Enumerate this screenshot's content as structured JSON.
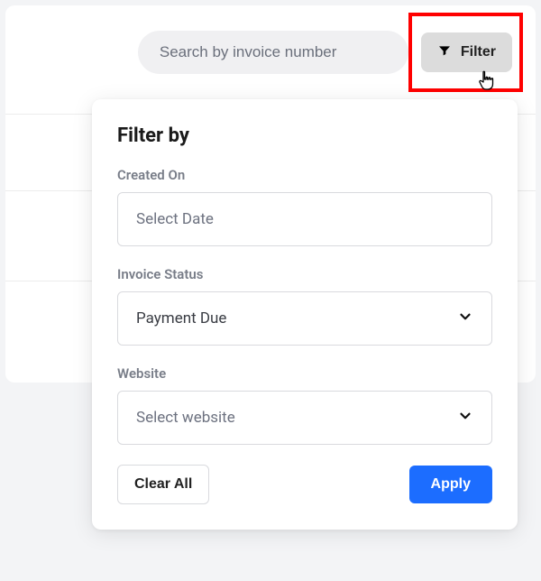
{
  "search": {
    "placeholder": "Search by invoice number"
  },
  "filter_button": {
    "label": "Filter"
  },
  "popover": {
    "title": "Filter by",
    "created_on": {
      "label": "Created On",
      "value": "Select Date"
    },
    "invoice_status": {
      "label": "Invoice Status",
      "value": "Payment Due"
    },
    "website": {
      "label": "Website",
      "value": "Select website"
    },
    "clear_label": "Clear All",
    "apply_label": "Apply"
  }
}
